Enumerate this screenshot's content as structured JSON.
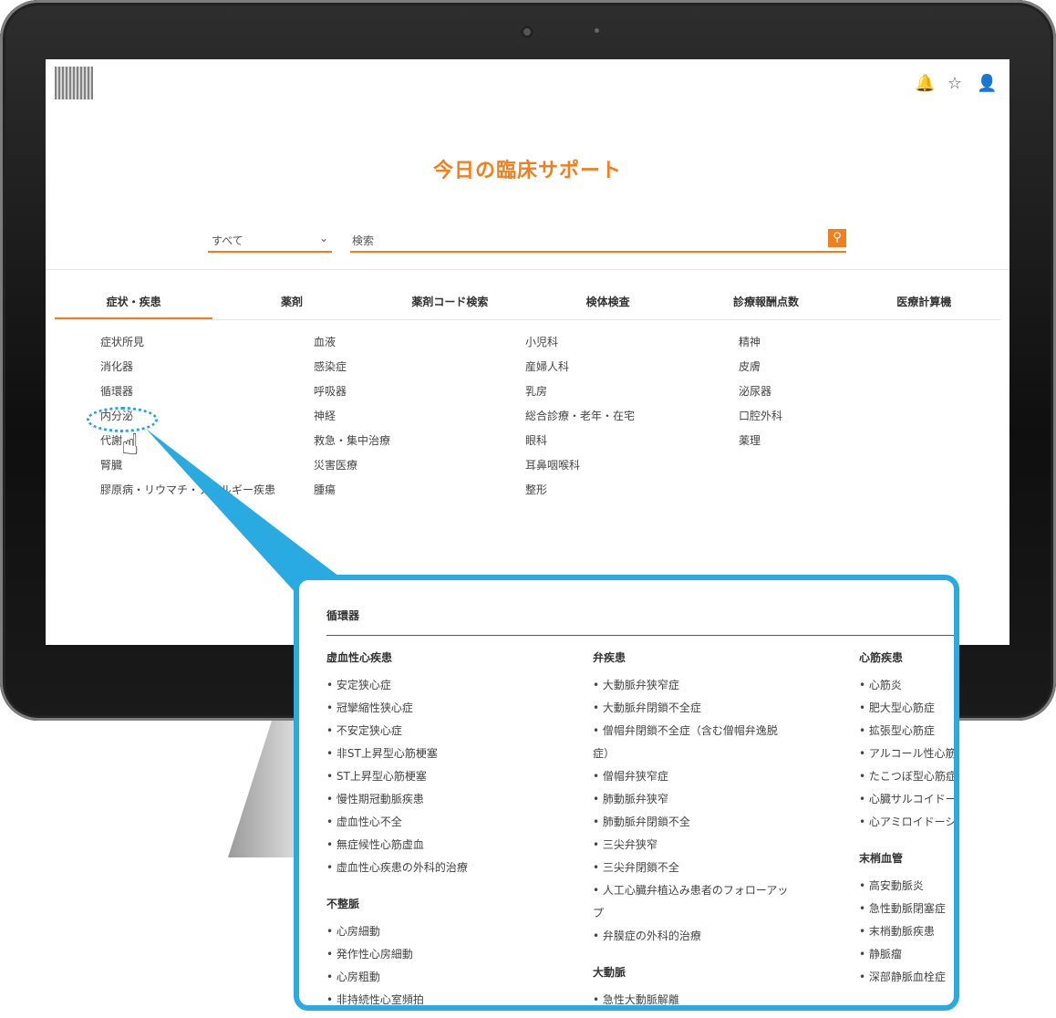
{
  "header": {
    "icons": [
      "bell-icon",
      "star-icon",
      "user-icon"
    ],
    "icon_glyphs": [
      "🔔",
      "☆",
      "👤"
    ]
  },
  "app_title": "今日の臨床サポート",
  "search": {
    "scope_selected": "すべて",
    "placeholder": "検索"
  },
  "tabs": [
    {
      "label": "症状・疾患",
      "active": true
    },
    {
      "label": "薬剤",
      "active": false
    },
    {
      "label": "薬剤コード検索",
      "active": false
    },
    {
      "label": "検体検査",
      "active": false
    },
    {
      "label": "診療報酬点数",
      "active": false
    },
    {
      "label": "医療計算機",
      "active": false
    }
  ],
  "categories": {
    "col1": [
      "症状所見",
      "消化器",
      "循環器",
      "内分泌",
      "代謝",
      "腎臓",
      "膠原病・リウマチ・アレルギー疾患"
    ],
    "col2": [
      "血液",
      "感染症",
      "呼吸器",
      "神経",
      "救急・集中治療",
      "災害医療",
      "腫瘍"
    ],
    "col3": [
      "小児科",
      "産婦人科",
      "乳房",
      "総合診療・老年・在宅",
      "眼科",
      "耳鼻咽喉科",
      "整形"
    ],
    "col4": [
      "精神",
      "皮膚",
      "泌尿器",
      "口腔外科",
      "薬理"
    ]
  },
  "callout": {
    "title": "循環器",
    "col1": {
      "sections": [
        {
          "heading": "虚血性心疾患",
          "items": [
            "安定狭心症",
            "冠攣縮性狭心症",
            "不安定狭心症",
            "非ST上昇型心筋梗塞",
            "ST上昇型心筋梗塞",
            "慢性期冠動脈疾患",
            "虚血性心不全",
            "無症候性心筋虚血",
            "虚血性心疾患の外科的治療"
          ]
        },
        {
          "heading": "不整脈",
          "items": [
            "心房細動",
            "発作性心房細動",
            "心房粗動",
            "非持続性心室頻拍"
          ]
        }
      ]
    },
    "col2": {
      "sections": [
        {
          "heading": "弁疾患",
          "items": [
            "大動脈弁狭窄症",
            "大動脈弁閉鎖不全症",
            "僧帽弁閉鎖不全症（含む僧帽弁逸脱症）",
            "僧帽弁狭窄症",
            "肺動脈弁狭窄",
            "肺動脈弁閉鎖不全",
            "三尖弁狭窄",
            "三尖弁閉鎖不全",
            "人工心臓弁植込み患者のフォローアップ",
            "弁膜症の外科的治療"
          ]
        },
        {
          "heading": "大動脈",
          "items": [
            "急性大動脈解離"
          ]
        }
      ]
    },
    "col3": {
      "sections": [
        {
          "heading": "心筋疾患",
          "items": [
            "心筋炎",
            "肥大型心筋症",
            "拡張型心筋症",
            "アルコール性心筋症",
            "たこつぼ型心筋症",
            "心臓サルコイドーシス",
            "心アミロイドーシス"
          ]
        },
        {
          "heading": "末梢血管",
          "items": [
            "高安動脈炎",
            "急性動脈閉塞症",
            "末梢動脈疾患",
            "静脈瘤",
            "深部静脈血栓症"
          ]
        }
      ]
    }
  }
}
